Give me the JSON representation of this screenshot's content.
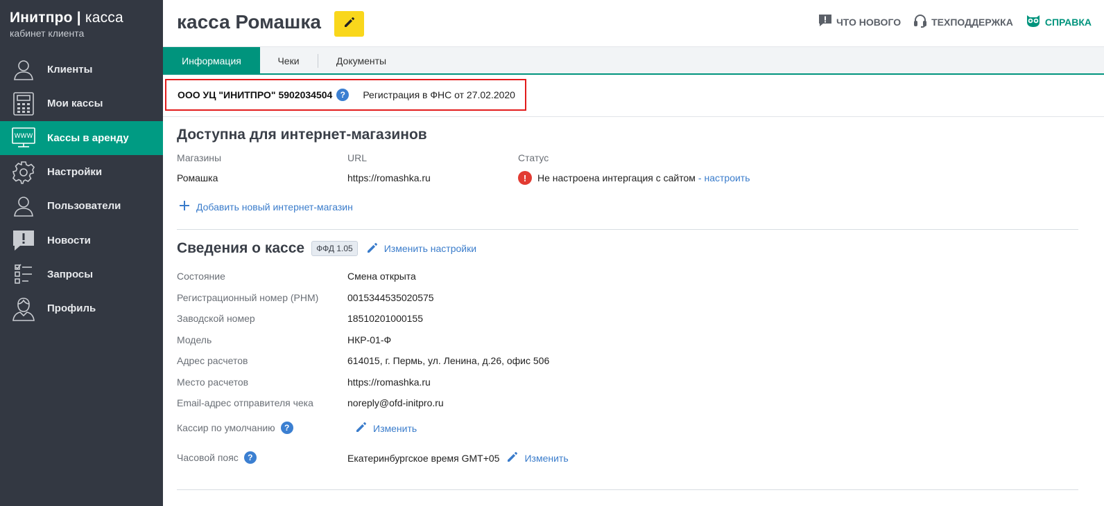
{
  "sidebar": {
    "logo_title": "Инитпро",
    "logo_title_part2": "касса",
    "logo_subtitle": "кабинет клиента",
    "items": [
      {
        "label": "Клиенты",
        "icon": "users-icon"
      },
      {
        "label": "Мои кассы",
        "icon": "cash-register-icon"
      },
      {
        "label": "Кассы в аренду",
        "icon": "www-monitor-icon",
        "active": true
      },
      {
        "label": "Настройки",
        "icon": "gear-icon"
      },
      {
        "label": "Пользователи",
        "icon": "user-icon"
      },
      {
        "label": "Новости",
        "icon": "news-icon"
      },
      {
        "label": "Запросы",
        "icon": "checklist-icon"
      },
      {
        "label": "Профиль",
        "icon": "profile-icon"
      }
    ]
  },
  "header": {
    "title": "касса Ромашка",
    "links": {
      "whats_new": "ЧТО НОВОГО",
      "support": "ТЕХПОДДЕРЖКА",
      "help": "СПРАВКА"
    }
  },
  "tabs": [
    {
      "label": "Информация",
      "active": true
    },
    {
      "label": "Чеки"
    },
    {
      "label": "Документы"
    }
  ],
  "org": {
    "name": "ООО УЦ \"ИНИТПРО\" 5902034504",
    "registration": "Регистрация в ФНС от 27.02.2020"
  },
  "shops": {
    "title": "Доступна для интернет-магазинов",
    "columns": [
      "Магазины",
      "URL",
      "Статус"
    ],
    "rows": [
      {
        "name": "Ромашка",
        "url": "https://romashka.ru",
        "status": "Не настроена интергация с сайтом",
        "status_link": "- настроить"
      }
    ],
    "add_link": "Добавить новый интернет-магазин"
  },
  "kassa": {
    "title": "Сведения о кассе",
    "ffd_badge": "ФФД 1.05",
    "edit_settings": "Изменить настройки",
    "fields": [
      {
        "label": "Состояние",
        "value": "Смена открыта"
      },
      {
        "label": "Регистрационный номер (РНМ)",
        "value": "0015344535020575"
      },
      {
        "label": "Заводской номер",
        "value": "18510201000155"
      },
      {
        "label": "Модель",
        "value": "НКР-01-Ф"
      },
      {
        "label": "Адрес расчетов",
        "value": "614015, г. Пермь, ул. Ленина, д.26, офис 506"
      },
      {
        "label": "Место расчетов",
        "value": "https://romashka.ru"
      },
      {
        "label": "Email-адрес отправителя чека",
        "value": "noreply@ofd-initpro.ru"
      }
    ],
    "cashier_label": "Кассир по умолчанию",
    "cashier_change": "Изменить",
    "timezone_label": "Часовой пояс",
    "timezone_value": "Екатеринбургское время GMT+05",
    "timezone_change": "Изменить"
  },
  "colors": {
    "sidebar_bg": "#333842",
    "accent": "#009b83",
    "highlight_border": "#e21b1b",
    "edit_button": "#f9d71c",
    "link": "#3a7ccb"
  }
}
